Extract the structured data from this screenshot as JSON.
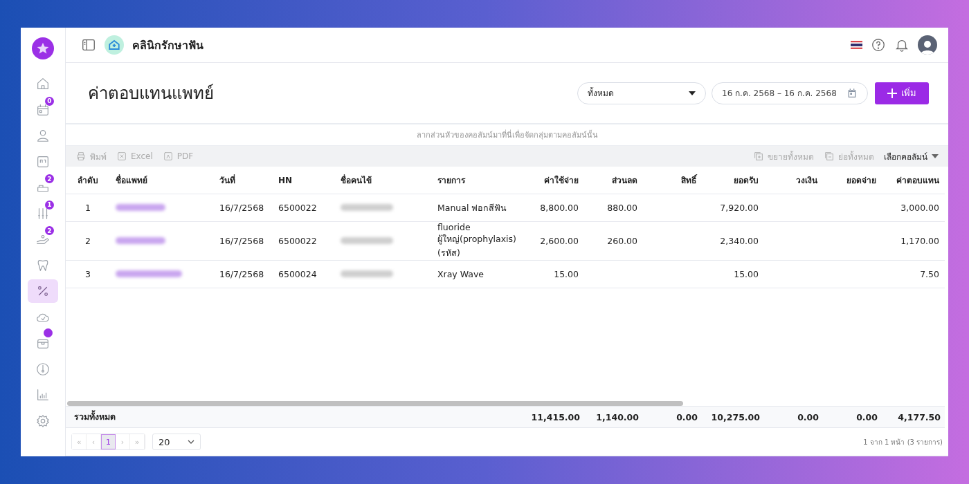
{
  "sidebar": {
    "items": [
      {
        "kind": "home",
        "selected": false
      },
      {
        "kind": "calendar",
        "badge": "0",
        "selected": false
      },
      {
        "kind": "user",
        "selected": false
      },
      {
        "kind": "card",
        "selected": false
      },
      {
        "kind": "bed",
        "badge": "2",
        "selected": false
      },
      {
        "kind": "tools",
        "badge": "1",
        "selected": false
      },
      {
        "kind": "hand",
        "badge": "2",
        "selected": false
      },
      {
        "kind": "tooth",
        "selected": false
      },
      {
        "kind": "percent",
        "selected": true
      },
      {
        "kind": "cloud",
        "selected": false
      },
      {
        "kind": "box",
        "dot": true,
        "selected": false
      },
      {
        "kind": "gauge",
        "selected": false
      },
      {
        "kind": "chart",
        "selected": false
      },
      {
        "kind": "gear",
        "selected": false
      }
    ]
  },
  "topbar": {
    "clinic_name": "คลินิกรักษาฟัน"
  },
  "page": {
    "title": "ค่าตอบแทนแพทย์",
    "filter": "ทั้งหมด",
    "date_range": "16 ก.ค. 2568 – 16 ก.ค. 2568",
    "add_button": "เพิ่ม"
  },
  "group_panel": {
    "hint": "ลากส่วนหัวของคอลัมน์มาที่นี่เพื่อจัดกลุ่มตามคอลัมน์นั้น"
  },
  "toolbar": {
    "left": [
      {
        "kind": "print",
        "label": "พิมพ์"
      },
      {
        "kind": "excel",
        "label": "Excel"
      },
      {
        "kind": "pdf",
        "label": "PDF"
      }
    ],
    "expand_all": "ขยายทั้งหมด",
    "collapse_all": "ย่อทั้งหมด",
    "column_chooser": "เลือกคอลัมน์"
  },
  "table": {
    "columns": [
      "ลำดับ",
      "ชื่อแพทย์",
      "วันที่",
      "HN",
      "ชื่อคนไข้",
      "รายการ",
      "ค่าใช้จ่าย",
      "ส่วนลด",
      "สิทธิ์",
      "ยอดรับ",
      "วงเงิน",
      "ยอดจ่าย",
      "ค่าตอบแทน"
    ],
    "rows": [
      [
        "1",
        "",
        "16/7/2568",
        "6500022",
        "",
        "Manual ฟอกสีฟัน",
        "8,800.00",
        "880.00",
        "",
        "7,920.00",
        "",
        "",
        "3,000.00"
      ],
      [
        "2",
        "",
        "16/7/2568",
        "6500022",
        "",
        "fluoride ผู้ใหญ่(prophylaxis)(รหัส)",
        "2,600.00",
        "260.00",
        "",
        "2,340.00",
        "",
        "",
        "1,170.00"
      ],
      [
        "3",
        "",
        "16/7/2568",
        "6500024",
        "",
        "Xray Wave",
        "15.00",
        "",
        "",
        "15.00",
        "",
        "",
        "7.50"
      ]
    ],
    "totals_label": "รวมทั้งหมด",
    "totals": [
      "11,415.00",
      "1,140.00",
      "0.00",
      "10,275.00",
      "0.00",
      "0.00",
      "4,177.50"
    ]
  },
  "pager": {
    "first": "«",
    "prev": "‹",
    "pages": [
      {
        "label": "1",
        "selected": true
      }
    ],
    "next": "›",
    "last": "»",
    "page_size": "20",
    "summary": "1 จาก 1 หน้า (3 รายการ)"
  }
}
